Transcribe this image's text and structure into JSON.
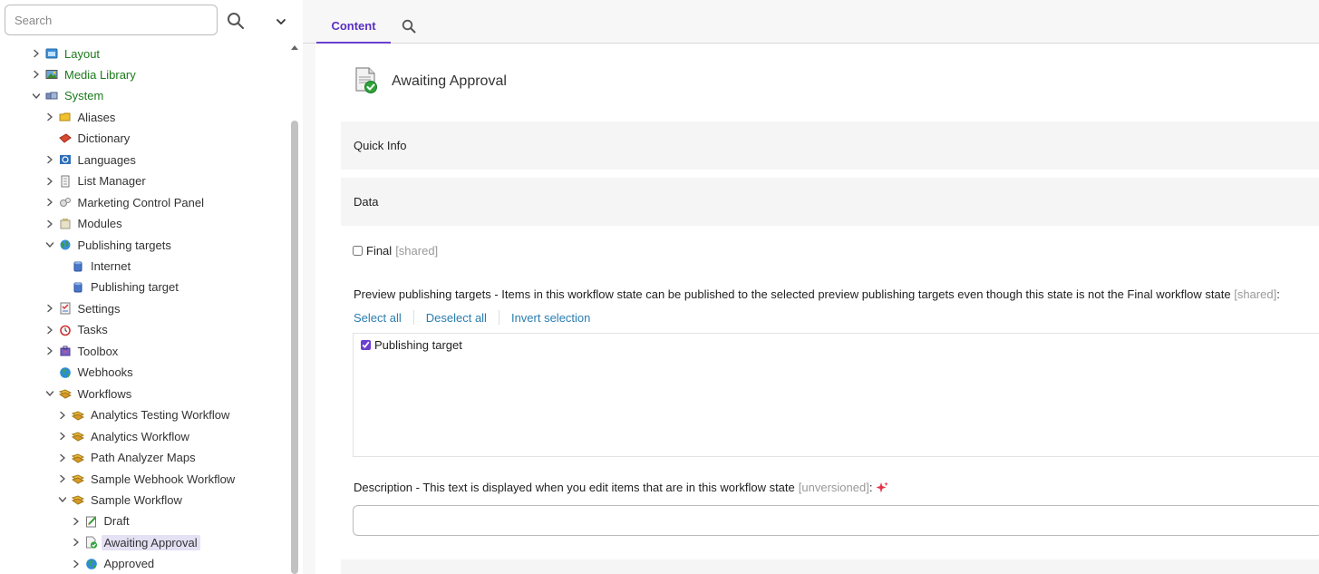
{
  "search": {
    "placeholder": "Search"
  },
  "tree": [
    {
      "label": "Layout",
      "level": 0,
      "arrow": "right",
      "icon": "layout-icon",
      "green": true
    },
    {
      "label": "Media Library",
      "level": 0,
      "arrow": "right",
      "icon": "media-library-icon",
      "green": true
    },
    {
      "label": "System",
      "level": 0,
      "arrow": "down",
      "icon": "system-icon",
      "green": true
    },
    {
      "label": "Aliases",
      "level": 1,
      "arrow": "right",
      "icon": "folder-icon"
    },
    {
      "label": "Dictionary",
      "level": 1,
      "arrow": "none",
      "icon": "dictionary-icon"
    },
    {
      "label": "Languages",
      "level": 1,
      "arrow": "right",
      "icon": "languages-icon"
    },
    {
      "label": "List Manager",
      "level": 1,
      "arrow": "right",
      "icon": "list-manager-icon"
    },
    {
      "label": "Marketing Control Panel",
      "level": 1,
      "arrow": "right",
      "icon": "marketing-icon"
    },
    {
      "label": "Modules",
      "level": 1,
      "arrow": "right",
      "icon": "modules-icon"
    },
    {
      "label": "Publishing targets",
      "level": 1,
      "arrow": "down",
      "icon": "publishing-targets-icon"
    },
    {
      "label": "Internet",
      "level": 2,
      "arrow": "none",
      "icon": "database-icon"
    },
    {
      "label": "Publishing target",
      "level": 2,
      "arrow": "none",
      "icon": "database-icon"
    },
    {
      "label": "Settings",
      "level": 1,
      "arrow": "right",
      "icon": "settings-icon"
    },
    {
      "label": "Tasks",
      "level": 1,
      "arrow": "right",
      "icon": "tasks-icon"
    },
    {
      "label": "Toolbox",
      "level": 1,
      "arrow": "right",
      "icon": "toolbox-icon"
    },
    {
      "label": "Webhooks",
      "level": 1,
      "arrow": "none",
      "icon": "globe-icon"
    },
    {
      "label": "Workflows",
      "level": 1,
      "arrow": "down",
      "icon": "workflow-icon"
    },
    {
      "label": "Analytics Testing Workflow",
      "level": 2,
      "arrow": "right",
      "icon": "workflow-icon"
    },
    {
      "label": "Analytics Workflow",
      "level": 2,
      "arrow": "right",
      "icon": "workflow-icon"
    },
    {
      "label": "Path Analyzer Maps",
      "level": 2,
      "arrow": "right",
      "icon": "workflow-icon"
    },
    {
      "label": "Sample Webhook Workflow",
      "level": 2,
      "arrow": "right",
      "icon": "workflow-icon"
    },
    {
      "label": "Sample Workflow",
      "level": 2,
      "arrow": "down",
      "icon": "workflow-icon"
    },
    {
      "label": "Draft",
      "level": 3,
      "arrow": "right",
      "icon": "draft-icon"
    },
    {
      "label": "Awaiting Approval",
      "level": 3,
      "arrow": "right",
      "icon": "awaiting-approval-icon",
      "selected": true
    },
    {
      "label": "Approved",
      "level": 3,
      "arrow": "right",
      "icon": "globe-icon"
    }
  ],
  "tabs": {
    "content": "Content"
  },
  "item": {
    "title": "Awaiting Approval"
  },
  "sections": {
    "quick_info": "Quick Info",
    "data": "Data"
  },
  "fields": {
    "final_label": "Final",
    "final_shared": "[shared]",
    "final_checked": false,
    "preview_label": "Preview publishing targets - Items in this workflow state can be published to the selected preview publishing targets even though this state is not the Final workflow state",
    "preview_shared": "[shared]",
    "preview_colon": ":",
    "select_all": "Select all",
    "deselect_all": "Deselect all",
    "invert_selection": "Invert selection",
    "target_label": "Publishing target",
    "target_checked": true,
    "description_label": "Description - This text is displayed when you edit items that are in this workflow state",
    "description_unversioned": "[unversioned]",
    "description_colon": ":",
    "description_value": ""
  },
  "colors": {
    "accent": "#6a3fd0",
    "tree_green": "#1b7a1b",
    "link": "#2a7db0",
    "selected_bg": "#e5e1f4"
  }
}
